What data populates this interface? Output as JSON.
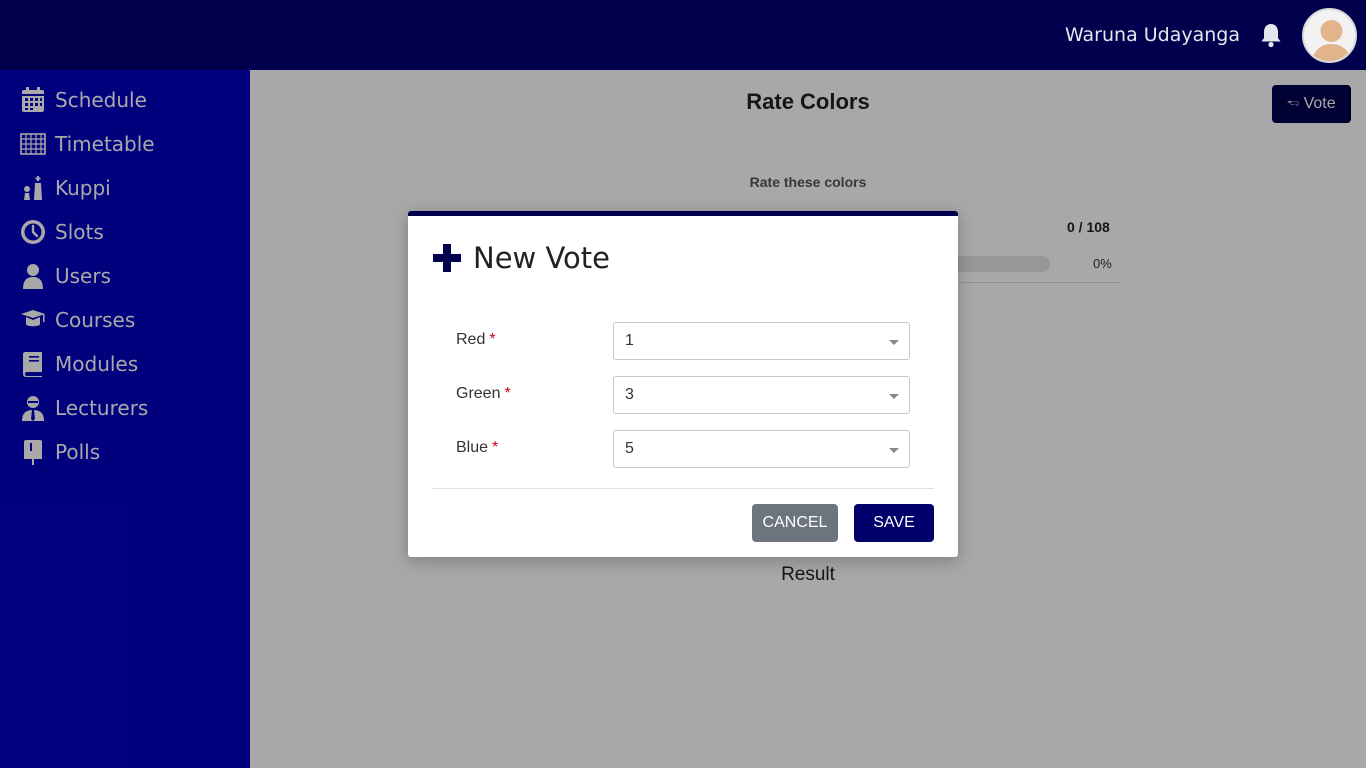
{
  "header": {
    "user_name": "Waruna Udayanga",
    "bell_icon": "bell-icon",
    "avatar_icon": "user-avatar"
  },
  "sidebar": {
    "items": [
      {
        "label": "Schedule",
        "icon": "calendar-icon"
      },
      {
        "label": "Timetable",
        "icon": "grid-table-icon"
      },
      {
        "label": "Kuppi",
        "icon": "chess-icon"
      },
      {
        "label": "Slots",
        "icon": "clock-icon"
      },
      {
        "label": "Users",
        "icon": "user-icon"
      },
      {
        "label": "Courses",
        "icon": "graduation-cap-icon"
      },
      {
        "label": "Modules",
        "icon": "book-icon"
      },
      {
        "label": "Lecturers",
        "icon": "lecturer-icon"
      },
      {
        "label": "Polls",
        "icon": "mailbox-icon"
      }
    ]
  },
  "main": {
    "title": "Rate Colors",
    "vote_button": "🖘 Vote",
    "subtitle": "Rate these colors",
    "count": "0 / 108",
    "progress_percent": "0%",
    "progress_value": 0,
    "result_label": "Result"
  },
  "modal": {
    "title": "New Vote",
    "icon": "plus-icon",
    "fields": [
      {
        "label": "Red",
        "required_mark": "*",
        "value": "1"
      },
      {
        "label": "Green",
        "required_mark": "*",
        "value": "3"
      },
      {
        "label": "Blue",
        "required_mark": "*",
        "value": "5"
      }
    ],
    "cancel_label": "CANCEL",
    "save_label": "SAVE"
  },
  "colors": {
    "topbar": "#00004d",
    "sidebar": "#0303c0",
    "primary_button": "#00006b",
    "cancel_button": "#6c757d",
    "required": "#d0021b"
  }
}
